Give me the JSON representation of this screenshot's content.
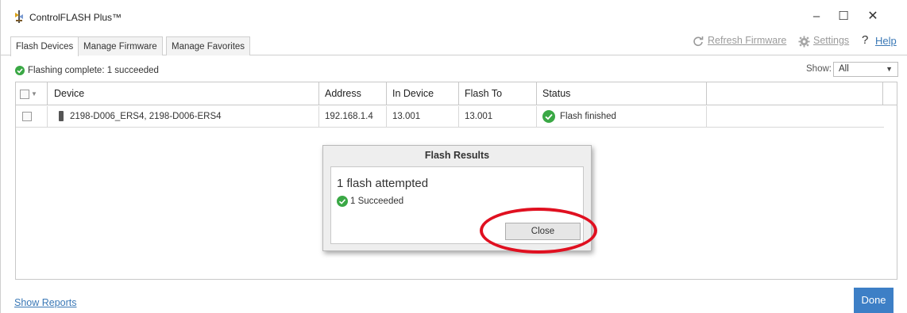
{
  "window": {
    "title": "ControlFLASH Plus™",
    "minimize_glyph": "–",
    "maximize_glyph": "☐",
    "close_glyph": "✕"
  },
  "tabs": [
    {
      "label": "Flash Devices",
      "active": true
    },
    {
      "label": "Manage Firmware",
      "active": false
    },
    {
      "label": "Manage Favorites",
      "active": false
    }
  ],
  "toolbar": {
    "refresh_label": "Refresh Firmware",
    "refresh_icon": "refresh-icon",
    "settings_label": "Settings",
    "settings_icon": "gear-icon",
    "help_glyph": "?",
    "help_label": "Help"
  },
  "status": {
    "text": "Flashing complete: 1 succeeded",
    "icon": "check-circle-icon",
    "color": "#3aa845"
  },
  "filter": {
    "label": "Show:",
    "value": "All",
    "arrow": "▼"
  },
  "table": {
    "columns": [
      "Device",
      "Address",
      "In Device",
      "Flash To",
      "Status",
      ""
    ],
    "rows": [
      {
        "device": "2198-D006_ERS4, 2198-D006-ERS4",
        "address": "192.168.1.4",
        "in_device": "13.001",
        "flash_to": "13.001",
        "status": "Flash finished"
      }
    ]
  },
  "dialog": {
    "title": "Flash Results",
    "attempted": "1 flash attempted",
    "succeeded": "1 Succeeded",
    "close_label": "Close"
  },
  "footer": {
    "show_reports": "Show Reports",
    "done_label": "Done"
  },
  "colors": {
    "accent": "#3d7fc6",
    "success": "#3aa845",
    "highlight": "#e01020",
    "link": "#3a78b6"
  }
}
